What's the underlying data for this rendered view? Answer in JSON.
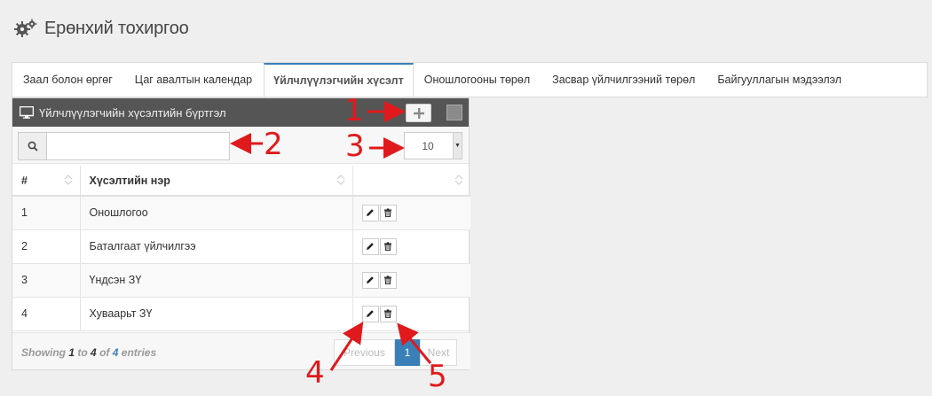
{
  "header": {
    "title": "Ерөнхий тохиргоо",
    "icon": "gears-icon"
  },
  "tabs": [
    {
      "label": "Заал болон өргөг",
      "active": false
    },
    {
      "label": "Цаг авалтын календар",
      "active": false
    },
    {
      "label": "Үйлчлүүлэгчийн хүсэлт",
      "active": true
    },
    {
      "label": "Оношлогооны төрөл",
      "active": false
    },
    {
      "label": "Засвар үйлчилгээний төрөл",
      "active": false
    },
    {
      "label": "Байгууллагын мэдээлэл",
      "active": false
    }
  ],
  "panel": {
    "title": "Үйлчлүүлэгчийн хүсэлтийн бүртгэл",
    "icon": "monitor-icon",
    "add_icon": "plus-icon"
  },
  "search": {
    "value": "",
    "placeholder": ""
  },
  "page_length": {
    "value": "10"
  },
  "table": {
    "columns": [
      "#",
      "Хүсэлтийн нэр",
      ""
    ],
    "rows": [
      {
        "num": "1",
        "name": "Оношлогоо"
      },
      {
        "num": "2",
        "name": "Баталгаат үйлчилгээ"
      },
      {
        "num": "3",
        "name": "Үндсэн ЗҮ"
      },
      {
        "num": "4",
        "name": "Хуваарьт ЗҮ"
      }
    ]
  },
  "footer": {
    "info_prefix": "Showing",
    "from": "1",
    "to_word": "to",
    "to": "4",
    "of_word": "of",
    "total": "4",
    "suffix": "entries",
    "prev": "Previous",
    "current_page": "1",
    "next": "Next"
  },
  "annotations": [
    "1",
    "2",
    "3",
    "4",
    "5"
  ],
  "colors": {
    "accent": "#3a7fb7",
    "annotation": "#e0191c",
    "panel_head": "#555555"
  }
}
